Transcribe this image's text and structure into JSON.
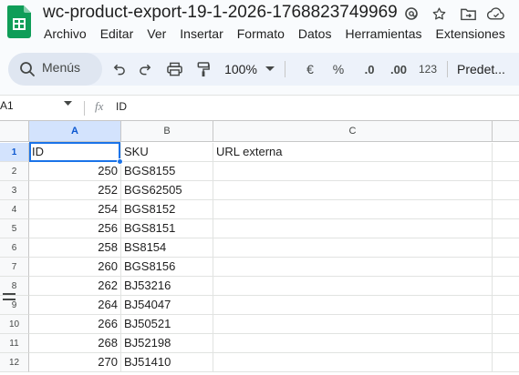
{
  "document": {
    "title": "wc-product-export-19-1-2026-1768823749969"
  },
  "title_icons": [
    "status-icon",
    "star-icon",
    "move-folder-icon",
    "cloud-status-icon"
  ],
  "menu": [
    "Archivo",
    "Editar",
    "Ver",
    "Insertar",
    "Formato",
    "Datos",
    "Herramientas",
    "Extensiones"
  ],
  "toolbar": {
    "search_label": "Menús",
    "zoom": "100%",
    "currency": "€",
    "percent": "%",
    "decrease_decimals": ".0",
    "increase_decimals": ".00",
    "number_format": "123",
    "font_label": "Predet..."
  },
  "formula_bar": {
    "name_box": "A1",
    "fx": "fx",
    "value": "ID"
  },
  "grid": {
    "columns": [
      "A",
      "B",
      "C"
    ],
    "selected_column": "A",
    "rows": [
      {
        "n": "1",
        "a": "ID",
        "b": "SKU",
        "c": "URL externa"
      },
      {
        "n": "2",
        "a": "250",
        "b": "BGS8155",
        "c": ""
      },
      {
        "n": "3",
        "a": "252",
        "b": "BGS62505",
        "c": ""
      },
      {
        "n": "4",
        "a": "254",
        "b": "BGS8152",
        "c": ""
      },
      {
        "n": "5",
        "a": "256",
        "b": "BGS8151",
        "c": ""
      },
      {
        "n": "6",
        "a": "258",
        "b": "BS8154",
        "c": ""
      },
      {
        "n": "7",
        "a": "260",
        "b": "BGS8156",
        "c": ""
      },
      {
        "n": "8",
        "a": "262",
        "b": "BJ53216",
        "c": ""
      },
      {
        "n": "9",
        "a": "264",
        "b": "BJ54047",
        "c": ""
      },
      {
        "n": "10",
        "a": "266",
        "b": "BJ50521",
        "c": ""
      },
      {
        "n": "11",
        "a": "268",
        "b": "BJ52198",
        "c": ""
      },
      {
        "n": "12",
        "a": "270",
        "b": "BJ51410",
        "c": ""
      }
    ]
  },
  "colors": {
    "accent": "#1a73e8",
    "selected_header": "#d3e3fd",
    "logo_green": "#0f9d58"
  }
}
